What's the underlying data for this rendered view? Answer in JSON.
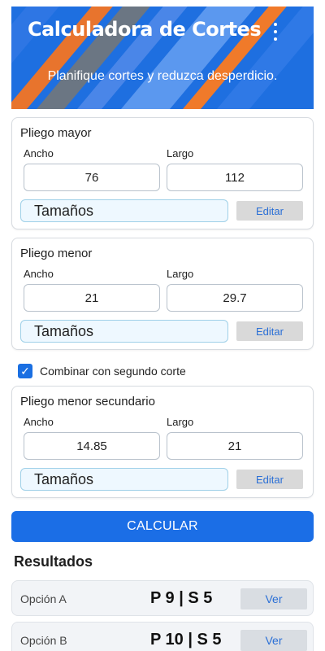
{
  "app": {
    "title": "Calculadora de Cortes",
    "subtitle": "Planifique cortes y reduzca desperdicio.",
    "menu_icon": "more-vertical-icon"
  },
  "colors": {
    "primary": "#1b6ee6",
    "banner_accent": "#e8742d",
    "edit_text": "#2a6fd6"
  },
  "pliego_mayor": {
    "title": "Pliego mayor",
    "ancho_label": "Ancho",
    "largo_label": "Largo",
    "ancho": "76",
    "largo": "112",
    "sizes_label": "Tamaños",
    "edit_label": "Editar"
  },
  "pliego_menor": {
    "title": "Pliego menor",
    "ancho_label": "Ancho",
    "largo_label": "Largo",
    "ancho": "21",
    "largo": "29.7",
    "sizes_label": "Tamaños",
    "edit_label": "Editar"
  },
  "combine": {
    "checked": true,
    "label": "Combinar con segundo corte"
  },
  "pliego_secundario": {
    "title": "Pliego menor secundario",
    "ancho_label": "Ancho",
    "largo_label": "Largo",
    "ancho": "14.85",
    "largo": "21",
    "sizes_label": "Tamaños",
    "edit_label": "Editar"
  },
  "calculate_label": "CALCULAR",
  "results": {
    "title": "Resultados",
    "options": [
      {
        "label": "Opción A",
        "value": "P 9 | S 5",
        "action": "Ver"
      },
      {
        "label": "Opción B",
        "value": "P 10 | S 5",
        "action": "Ver"
      }
    ]
  }
}
